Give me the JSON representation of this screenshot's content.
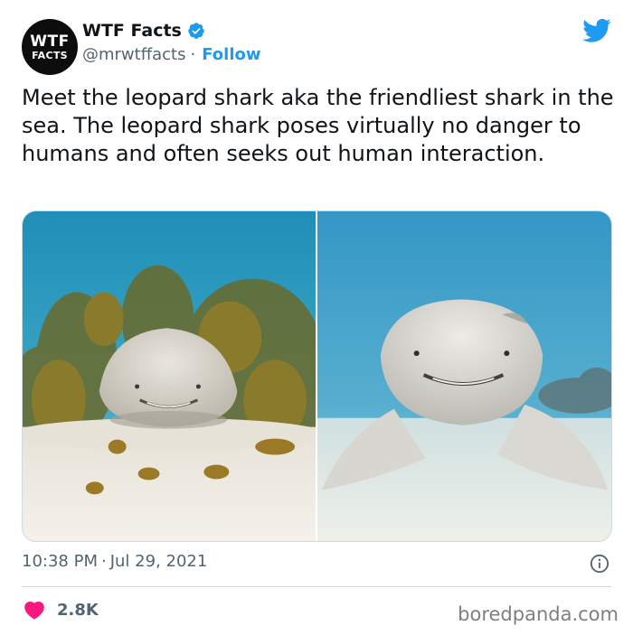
{
  "author": {
    "avatar_line1": "WTF",
    "avatar_line2": "FACTS",
    "display_name": "WTF Facts",
    "handle": "@mrwtffacts",
    "separator": "·",
    "follow_label": "Follow",
    "verified": true
  },
  "tweet": {
    "text": "Meet the leopard shark aka the friendliest shark in the sea. The leopard shark poses virtually no danger to humans and often seeks out human interaction.",
    "time": "10:38 PM",
    "separator": "·",
    "date": "Jul 29, 2021",
    "likes": "2.8K"
  },
  "icons": {
    "brand": "twitter-bird-icon",
    "verified": "verified-badge-icon",
    "info": "info-icon",
    "like": "heart-icon"
  },
  "watermark": "boredpanda.com",
  "colors": {
    "accent": "#1d9bf0",
    "like": "#f91880",
    "secondary_text": "#536471"
  }
}
